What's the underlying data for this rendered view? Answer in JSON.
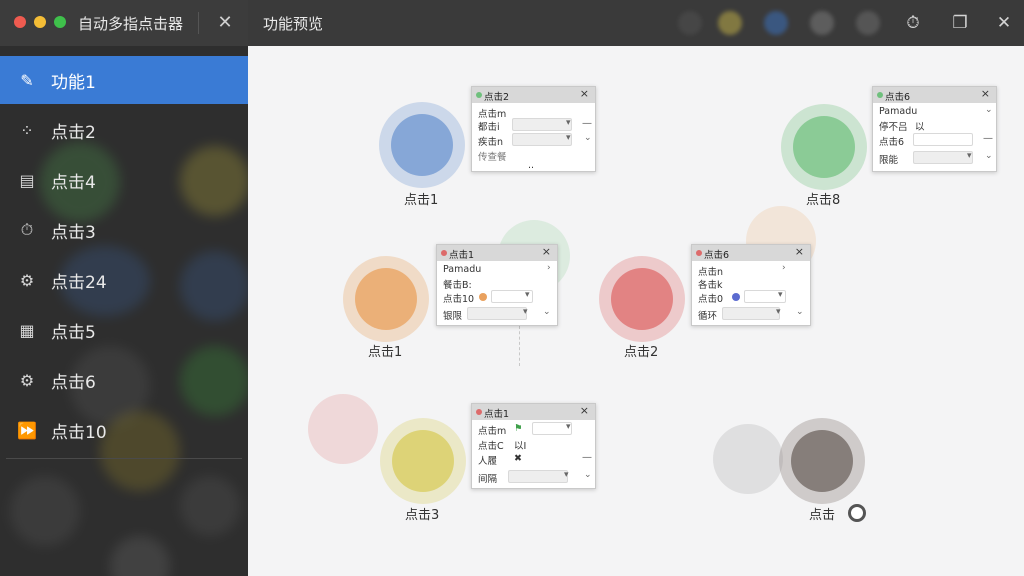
{
  "window": {
    "app_title": "自动多指点击器",
    "close_glyph": "✕",
    "page_title": "功能预览"
  },
  "toolbar": {
    "timer_icon": "timer-icon",
    "window_icon": "window-icon",
    "close_glyph": "✕"
  },
  "sidebar": {
    "items": [
      {
        "label": "功能1",
        "icon": "edit-icon",
        "glyph": "✎",
        "active": true
      },
      {
        "label": "点击2",
        "icon": "palette-icon",
        "glyph": "⁘",
        "active": false
      },
      {
        "label": "点击4",
        "icon": "document-icon",
        "glyph": "▤",
        "active": false
      },
      {
        "label": "点击3",
        "icon": "timer-icon",
        "glyph": "⏱",
        "active": false
      },
      {
        "label": "点击24",
        "icon": "gear-icon",
        "glyph": "⚙",
        "active": false
      },
      {
        "label": "点击5",
        "icon": "calendar-icon",
        "glyph": "▦",
        "active": false
      },
      {
        "label": "点击6",
        "icon": "gear-icon",
        "glyph": "⚙",
        "active": false
      },
      {
        "label": "点击10",
        "icon": "fast-forward-icon",
        "glyph": "⏩",
        "active": false
      }
    ]
  },
  "canvas": {
    "points": [
      {
        "label": "点击1",
        "color": "#6f97d0"
      },
      {
        "label": "点击8",
        "color": "#6fc07d"
      },
      {
        "label": "点击1",
        "color": "#e9a15e"
      },
      {
        "label": "点击2",
        "color": "#dd6b6b"
      },
      {
        "label": "点击3",
        "color": "#d8cc5c"
      },
      {
        "label": "点击",
        "color": "#8a7f7a"
      }
    ],
    "panels": [
      {
        "title": "点击2",
        "dot": "#6fc07d",
        "rows": [
          "点击m",
          "都击i",
          "疾击n",
          "传查餐"
        ],
        "footer": ".."
      },
      {
        "title": "点击6",
        "dot": "#6fc07d",
        "rows": [
          "Pamadu",
          "停不吕",
          "点击6",
          "限能"
        ],
        "row2_value": "以"
      },
      {
        "title": "点击1",
        "dot": "#dd6b6b",
        "rows": [
          "Pamadu",
          "餐击B:",
          "点击10",
          "银限"
        ]
      },
      {
        "title": "点击6",
        "dot": "#dd6b6b",
        "rows": [
          "点击n",
          "各击k",
          "点击0",
          "循环"
        ]
      },
      {
        "title": "点击1",
        "dot": "#dd6b6b",
        "rows": [
          "点击m",
          "点击C",
          "人履",
          "间隔"
        ],
        "row2_value": "以I"
      }
    ]
  },
  "colors": {
    "accent": "#3a7bd5",
    "sidebar_bg": "#2e2e2e",
    "canvas_bg": "#f4f4f5"
  }
}
